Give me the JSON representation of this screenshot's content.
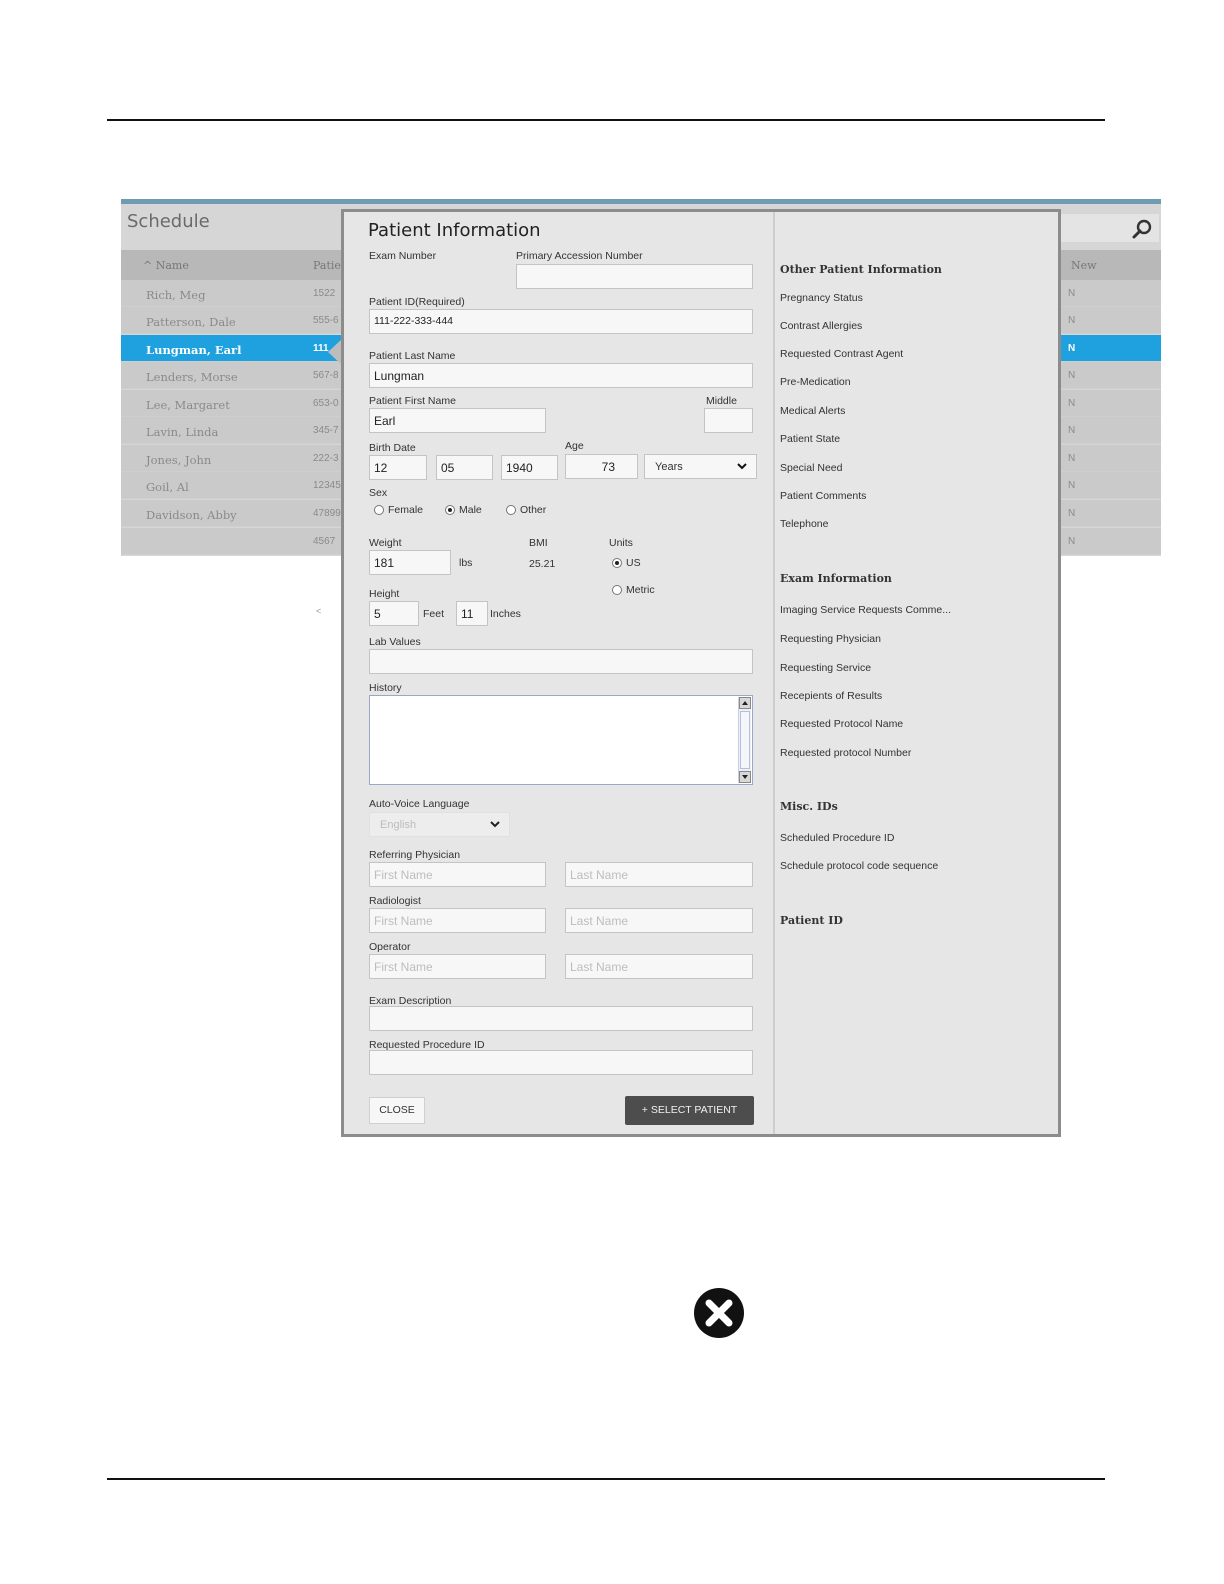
{
  "schedule": {
    "title": "Schedule",
    "columns": {
      "name": "^ Name",
      "patient_id": "Patie",
      "new": "New"
    },
    "rows": [
      {
        "name": "Rich, Meg",
        "id": "1522",
        "new": "N",
        "selected": false
      },
      {
        "name": "Patterson, Dale",
        "id": "555-6",
        "new": "N",
        "selected": false
      },
      {
        "name": "Lungman, Earl",
        "id": "111",
        "new": "N",
        "selected": true
      },
      {
        "name": "Lenders, Morse",
        "id": "567-8",
        "new": "N",
        "selected": false
      },
      {
        "name": "Lee, Margaret",
        "id": "653-0",
        "new": "N",
        "selected": false
      },
      {
        "name": "Lavin, Linda",
        "id": "345-7",
        "new": "N",
        "selected": false
      },
      {
        "name": "Jones, John",
        "id": "222-3",
        "new": "N",
        "selected": false
      },
      {
        "name": "Goil, Al",
        "id": "12345",
        "new": "N",
        "selected": false
      },
      {
        "name": "Davidson, Abby",
        "id": "47899",
        "new": "N",
        "selected": false
      },
      {
        "name": "",
        "id": "4567",
        "new": "N",
        "selected": false
      }
    ]
  },
  "small_arrow": "<",
  "modal": {
    "title": "Patient Information",
    "exam_number": {
      "label": "Exam Number"
    },
    "primary_accession": {
      "label": "Primary Accession Number",
      "value": ""
    },
    "patient_id": {
      "label": "Patient ID(Required)",
      "value": "111-222-333-444"
    },
    "last_name": {
      "label": "Patient Last Name",
      "value": "Lungman"
    },
    "first_name": {
      "label": "Patient First Name",
      "value": "Earl"
    },
    "middle": {
      "label": "Middle",
      "value": ""
    },
    "birth_date": {
      "label": "Birth Date",
      "month": "12",
      "day": "05",
      "year": "1940"
    },
    "age": {
      "label": "Age",
      "value": "73",
      "unit": "Years"
    },
    "sex": {
      "label": "Sex",
      "options": [
        "Female",
        "Male",
        "Other"
      ],
      "selected": "Male"
    },
    "weight": {
      "label": "Weight",
      "value": "181",
      "unit": "lbs"
    },
    "bmi": {
      "label": "BMI",
      "value": "25.21"
    },
    "units": {
      "label": "Units",
      "options": [
        "US",
        "Metric"
      ],
      "selected": "US"
    },
    "height": {
      "label": "Height",
      "feet": "5",
      "feet_label": "Feet",
      "inches": "11",
      "inches_label": "Inches"
    },
    "lab_values": {
      "label": "Lab Values",
      "value": ""
    },
    "history": {
      "label": "History",
      "value": ""
    },
    "auto_voice": {
      "label": "Auto-Voice Language",
      "value": "English"
    },
    "referring_physician": {
      "label": "Referring Physician",
      "first_placeholder": "First Name",
      "last_placeholder": "Last Name"
    },
    "radiologist": {
      "label": "Radiologist",
      "first_placeholder": "First Name",
      "last_placeholder": "Last Name"
    },
    "operator": {
      "label": "Operator",
      "first_placeholder": "First Name",
      "last_placeholder": "Last Name"
    },
    "exam_description": {
      "label": "Exam Description",
      "value": ""
    },
    "requested_procedure_id": {
      "label": "Requested Procedure ID",
      "value": ""
    },
    "close_button": "CLOSE",
    "select_button": "+ SELECT PATIENT"
  },
  "right_panel": {
    "other_heading": "Other Patient Information",
    "other_items": [
      "Pregnancy Status",
      "Contrast Allergies",
      "Requested Contrast Agent",
      "Pre-Medication",
      "Medical Alerts",
      "Patient State",
      "Special Need",
      "Patient Comments",
      "Telephone"
    ],
    "exam_heading": "Exam Information",
    "exam_items": [
      "Imaging Service Requests Comme...",
      "Requesting Physician",
      "Requesting Service",
      "Recepients of Results",
      "Requested Protocol Name",
      "Requested protocol Number"
    ],
    "misc_heading": "Misc. IDs",
    "misc_items": [
      "Scheduled Procedure ID",
      "Schedule protocol code sequence"
    ],
    "patient_id_heading": "Patient ID"
  },
  "colors": {
    "selected_row": "#1fa1e0",
    "select_button": "#4d4d4d",
    "modal_bg": "#e6e6e6"
  },
  "icons": [
    "search-icon",
    "chevron-down-icon",
    "close-x-icon"
  ]
}
